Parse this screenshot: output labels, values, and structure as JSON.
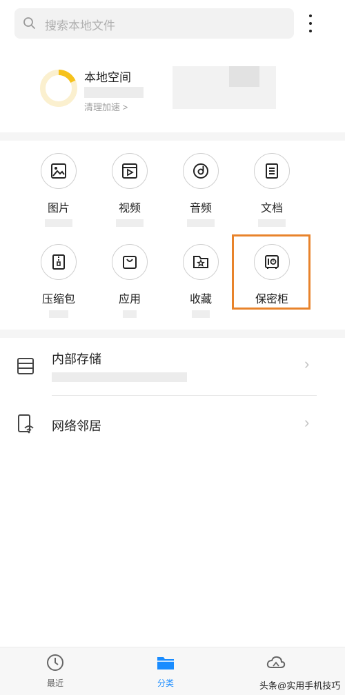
{
  "search": {
    "placeholder": "搜索本地文件",
    "icon": "search-icon"
  },
  "menu": {
    "icon": "more-vertical-icon"
  },
  "storage_card": {
    "title": "本地空间",
    "clean_link": "清理加速 >",
    "usage_fraction": 0.18,
    "ring_color": "#f6c21c",
    "ring_bg": "#fbf0cf"
  },
  "categories": [
    {
      "label": "图片",
      "icon": "image-icon"
    },
    {
      "label": "视频",
      "icon": "video-icon"
    },
    {
      "label": "音频",
      "icon": "audio-icon"
    },
    {
      "label": "文档",
      "icon": "document-icon"
    },
    {
      "label": "压缩包",
      "icon": "archive-icon"
    },
    {
      "label": "应用",
      "icon": "app-bag-icon"
    },
    {
      "label": "收藏",
      "icon": "favorites-icon"
    },
    {
      "label": "保密柜",
      "icon": "safe-icon"
    }
  ],
  "highlight_color": "#e8832b",
  "locations": [
    {
      "label": "内部存储",
      "icon": "storage-icon"
    },
    {
      "label": "网络邻居",
      "icon": "network-device-icon"
    }
  ],
  "bottom_nav": [
    {
      "label": "最近",
      "icon": "clock-icon",
      "active": false
    },
    {
      "label": "分类",
      "icon": "folder-icon",
      "active": true
    },
    {
      "label": "",
      "icon": "cloud-icon",
      "active": false
    }
  ],
  "accent": "#1a8cff",
  "watermark": "头条@实用手机技巧"
}
